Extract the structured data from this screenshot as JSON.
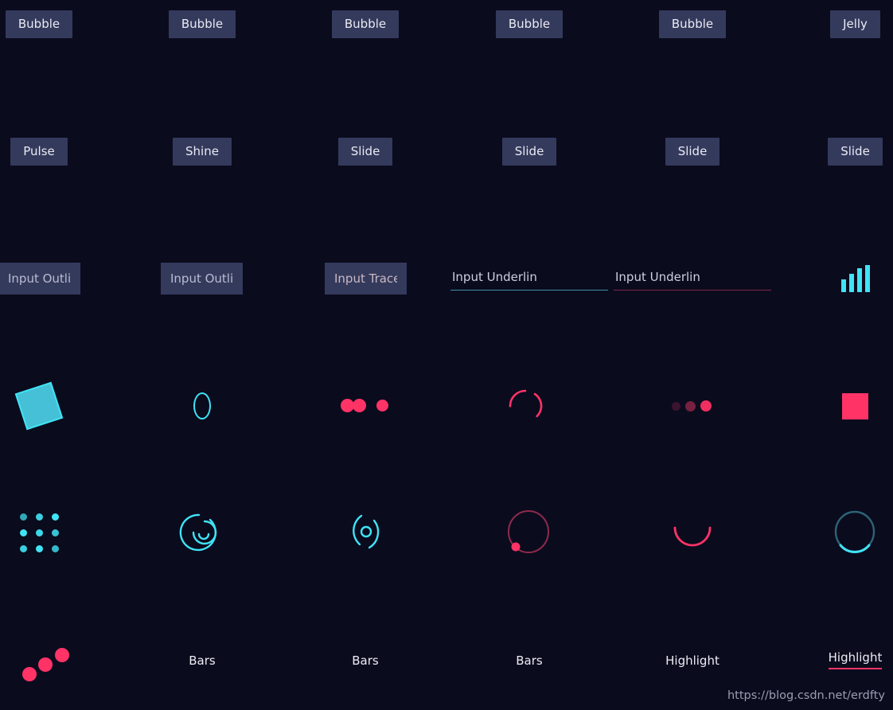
{
  "page": {
    "background": "#0b0b1e",
    "watermark": "https://blog.csdn.net/erdfty",
    "accent_cyan": "#3fe4f5",
    "accent_pink": "#ff3366",
    "control_bg": "#343a5c",
    "text_color": "#e9eaf3"
  },
  "row_buttons": [
    {
      "label": "Bubble"
    },
    {
      "label": "Bubble"
    },
    {
      "label": "Bubble"
    },
    {
      "label": "Bubble"
    },
    {
      "label": "Bubble"
    },
    {
      "label": "Jelly"
    }
  ],
  "row_buttons2": [
    {
      "label": "Pulse"
    },
    {
      "label": "Shine"
    },
    {
      "label": "Slide"
    },
    {
      "label": "Slide"
    },
    {
      "label": "Slide"
    },
    {
      "label": "Slide"
    }
  ],
  "row_inputs": [
    {
      "kind": "filled",
      "value": "Input Outline"
    },
    {
      "kind": "filled",
      "value": "Input Outline"
    },
    {
      "kind": "filled",
      "value": "Input Trace"
    },
    {
      "kind": "underline",
      "value": "Input Underlin",
      "underline_color": "#3f8fa0"
    },
    {
      "kind": "underline",
      "value": "Input Underlin",
      "underline_color": "#7e2746"
    },
    {
      "kind": "bars",
      "icon": "bars-icon"
    }
  ],
  "row_loaders_a": [
    {
      "icon": "rotating-square-loader"
    },
    {
      "icon": "ellipse-ring-loader"
    },
    {
      "icon": "three-dots-pink-loader"
    },
    {
      "icon": "split-arc-pink-loader"
    },
    {
      "icon": "fading-dots-pink-loader"
    },
    {
      "icon": "solid-square-pink-loader"
    }
  ],
  "row_loaders_b": [
    {
      "icon": "dot-grid-loader"
    },
    {
      "icon": "nested-arcs-cyan-loader"
    },
    {
      "icon": "orbit-ring-cyan-loader"
    },
    {
      "icon": "circle-dot-pink-loader"
    },
    {
      "icon": "half-arc-pink-loader"
    },
    {
      "icon": "ring-progress-cyan-loader"
    }
  ],
  "row_last": [
    {
      "kind": "icon",
      "icon": "diagonal-dots-pink-loader"
    },
    {
      "kind": "label",
      "label": "Bars"
    },
    {
      "kind": "label",
      "label": "Bars"
    },
    {
      "kind": "label",
      "label": "Bars"
    },
    {
      "kind": "label",
      "label": "Highlight"
    },
    {
      "kind": "label",
      "label": "Highlight",
      "underlined": true
    }
  ],
  "bars_heights": [
    16,
    23,
    30,
    34
  ]
}
